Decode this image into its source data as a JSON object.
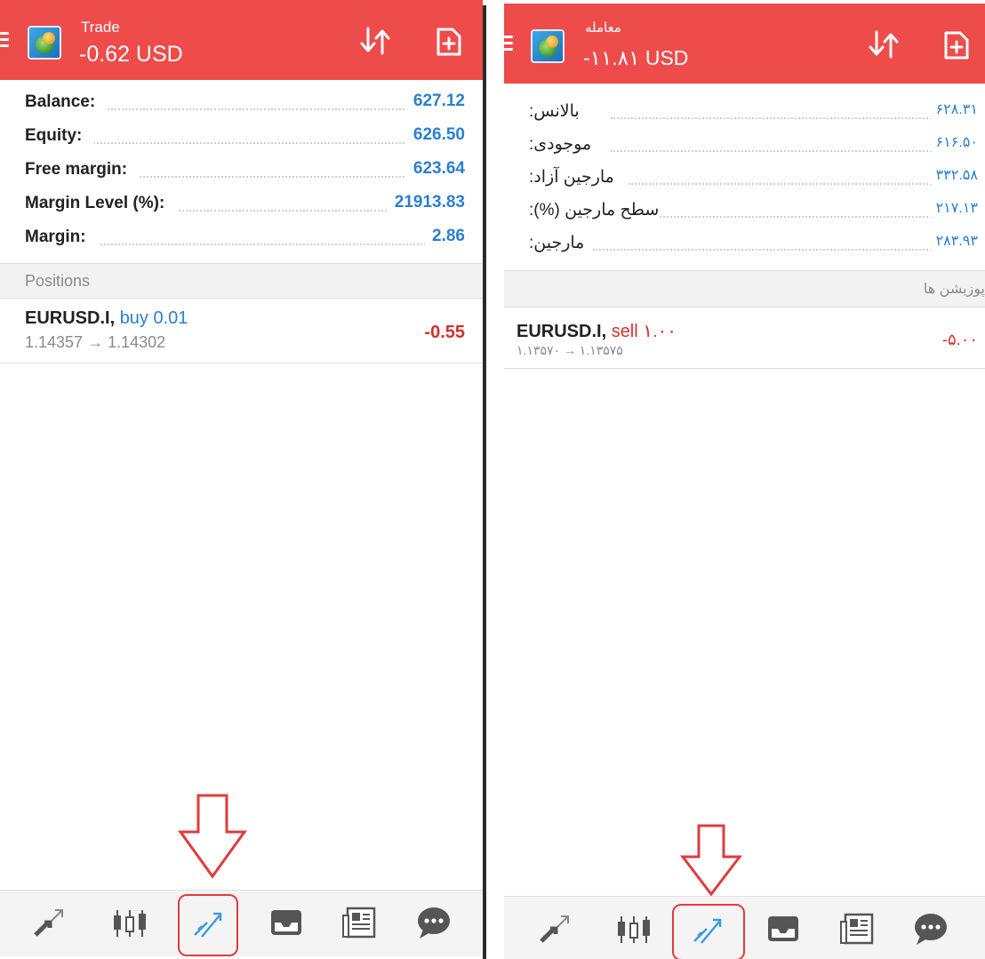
{
  "left": {
    "title": "Trade",
    "amount": "-0.62 USD",
    "account": [
      {
        "label": "Balance:",
        "value": "627.12"
      },
      {
        "label": "Equity:",
        "value": "626.50"
      },
      {
        "label": "Free margin:",
        "value": "623.64"
      },
      {
        "label": "Margin Level (%):",
        "value": "21913.83"
      },
      {
        "label": "Margin:",
        "value": "2.86"
      }
    ],
    "positions_label": "Positions",
    "position": {
      "symbol": "EURUSD.I,",
      "side": "buy 0.01",
      "side_color": "#2b7fd0",
      "prices": "1.14357 → 1.14302",
      "profit": "-0.55"
    }
  },
  "right": {
    "title": "معامله",
    "amount": "-۱۱.۸۱ USD",
    "account": [
      {
        "label": "بالانس:",
        "value": "۶۲۸.۳۱"
      },
      {
        "label": "موجودی:",
        "value": "۶۱۶.۵۰"
      },
      {
        "label": "مارجین آزاد:",
        "value": "۳۳۲.۵۸"
      },
      {
        "label": "سطح مارجین (%):",
        "value": "۲۱۷.۱۳"
      },
      {
        "label": "مارجین:",
        "value": "۲۸۳.۹۳"
      }
    ],
    "positions_label": "پوزیشن ها",
    "position": {
      "symbol": "EURUSD.I,",
      "side": "sell ۱.۰۰",
      "side_color": "#d2302c",
      "prices": "۱.۱۳۵۷۰ → ۱.۱۳۵۷۵",
      "profit": "-۵.۰۰"
    }
  },
  "bottom_nav": [
    "quotes-icon",
    "chart-icon",
    "trade-icon",
    "history-icon",
    "news-icon",
    "chat-icon"
  ],
  "colors": {
    "header": "#ee4b4b",
    "value_blue": "#2b7fd0",
    "loss_red": "#d2302c",
    "annotation_red": "#e23b3b",
    "active_nav": "#3e9be0"
  }
}
